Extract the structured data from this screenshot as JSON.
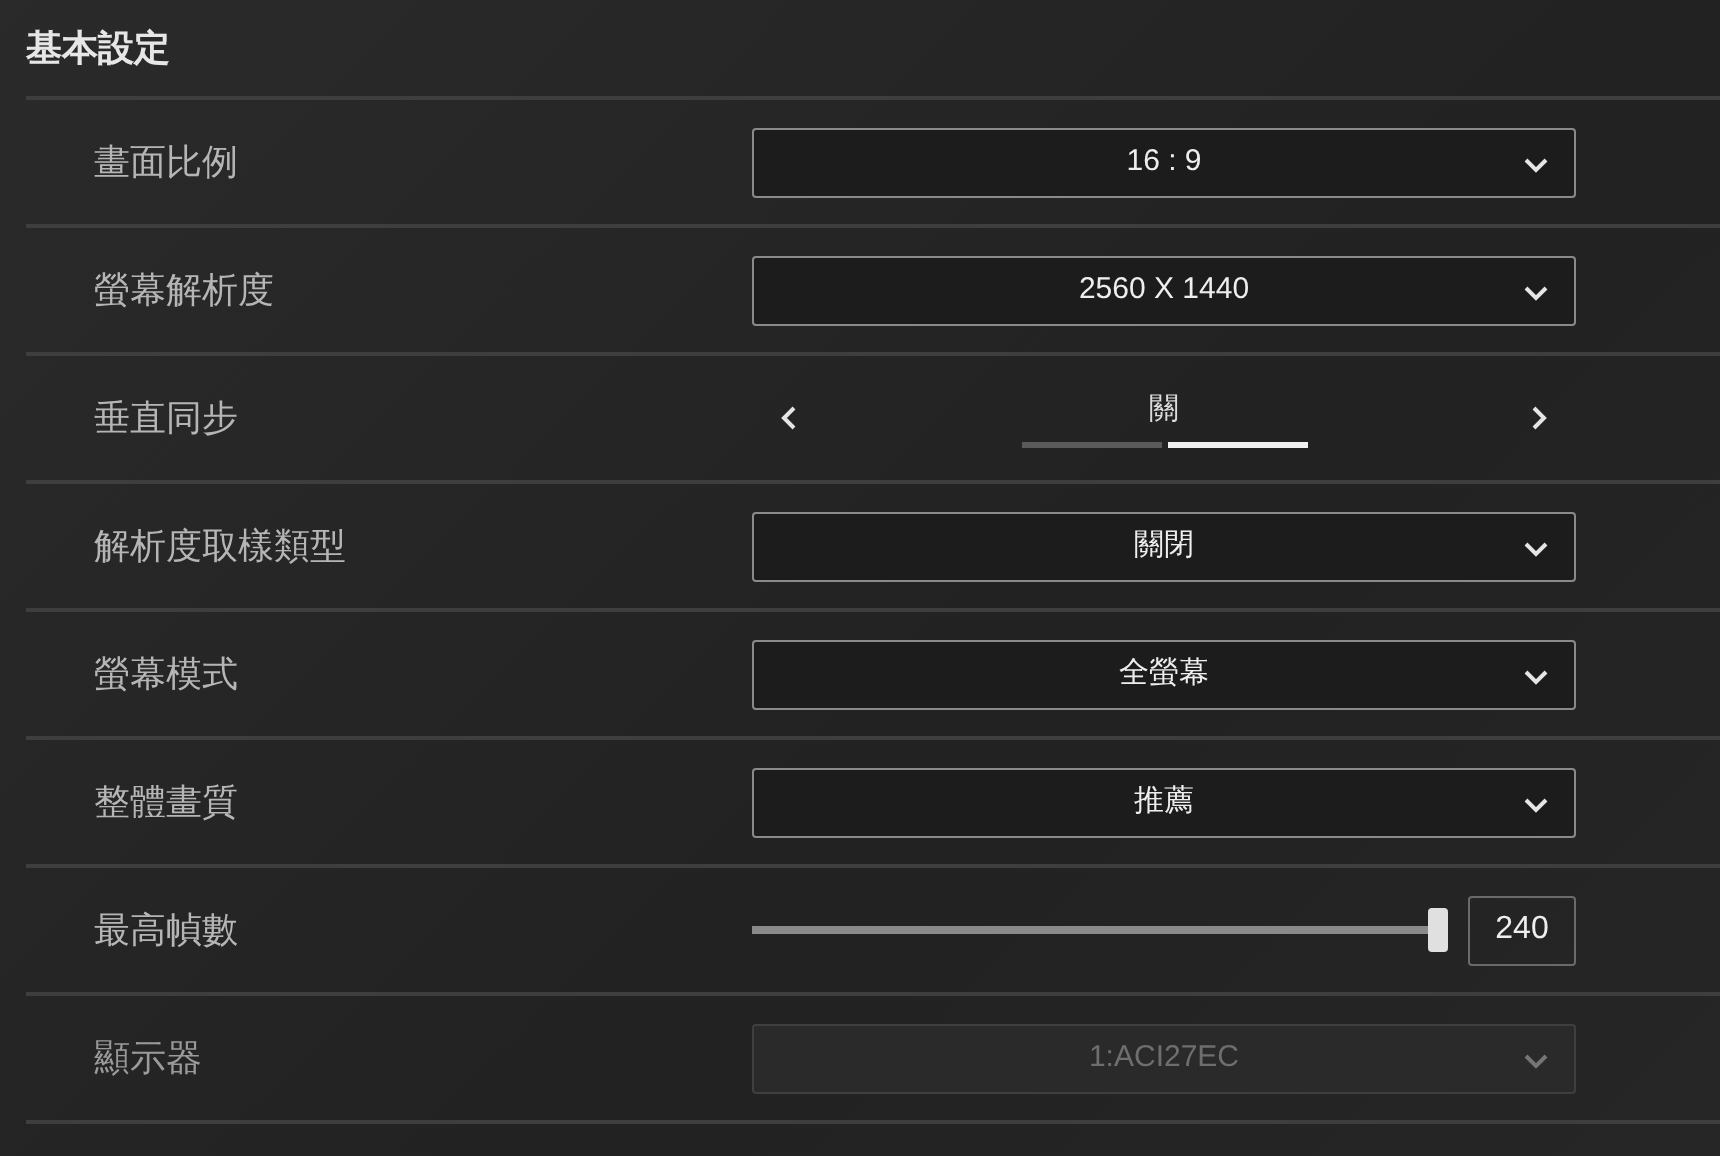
{
  "section_title": "基本設定",
  "settings": [
    {
      "kind": "dropdown",
      "label": "畫面比例",
      "value": "16 : 9",
      "disabled": false
    },
    {
      "kind": "dropdown",
      "label": "螢幕解析度",
      "value": "2560 X 1440",
      "disabled": false
    },
    {
      "kind": "selector",
      "label": "垂直同步",
      "value": "關",
      "segments": [
        {
          "selected": false
        },
        {
          "selected": true
        }
      ]
    },
    {
      "kind": "dropdown",
      "label": "解析度取樣類型",
      "value": "關閉",
      "disabled": false
    },
    {
      "kind": "dropdown",
      "label": "螢幕模式",
      "value": "全螢幕",
      "disabled": false
    },
    {
      "kind": "dropdown",
      "label": "整體畫質",
      "value": "推薦",
      "disabled": false
    },
    {
      "kind": "slider",
      "label": "最高幀數",
      "level": 1,
      "reading": "240"
    },
    {
      "kind": "dropdown",
      "label": "顯示器",
      "value": "1:ACI27EC",
      "disabled": true
    }
  ]
}
